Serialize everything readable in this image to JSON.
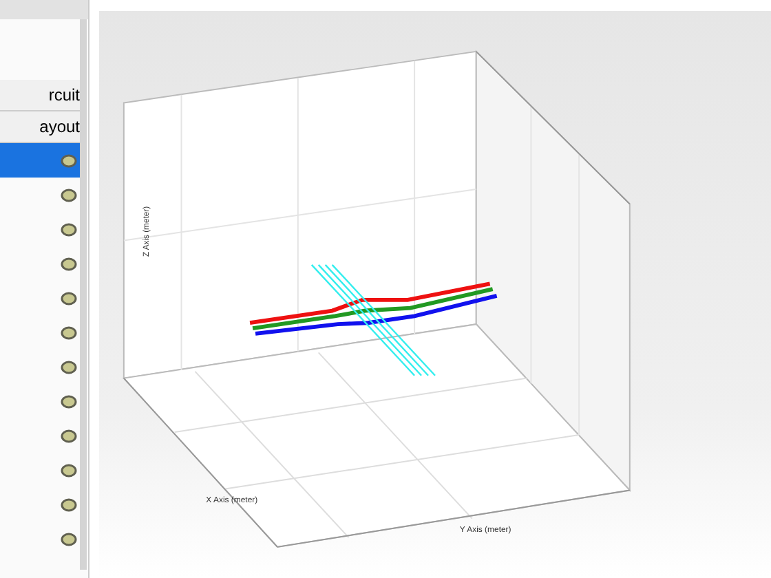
{
  "sidebar": {
    "headers": [
      {
        "label": "rcuit"
      },
      {
        "label": "ayout"
      }
    ],
    "rows": [
      {
        "selected": true
      },
      {
        "selected": false
      },
      {
        "selected": false
      },
      {
        "selected": false
      },
      {
        "selected": false
      },
      {
        "selected": false
      },
      {
        "selected": false
      },
      {
        "selected": false
      },
      {
        "selected": false
      },
      {
        "selected": false
      },
      {
        "selected": false
      },
      {
        "selected": false
      }
    ]
  },
  "plot": {
    "x_label": "X Axis (meter)",
    "y_label": "Y Axis (meter)",
    "z_label": "Z Axis (meter)"
  }
}
